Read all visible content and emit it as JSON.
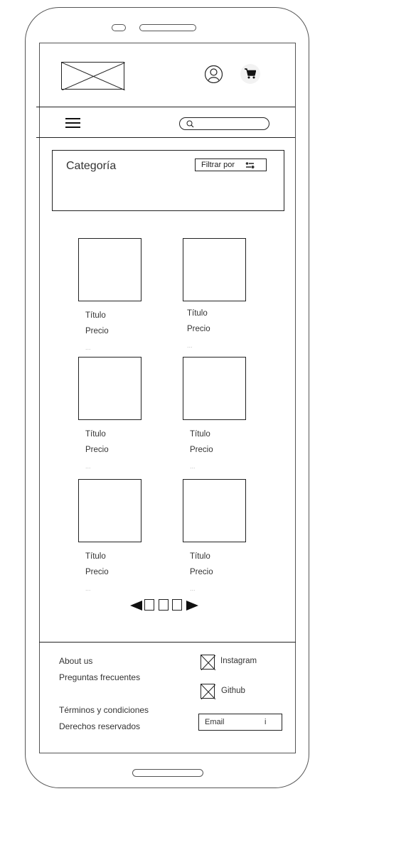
{
  "header": {
    "logo_icon": "image-placeholder-icon",
    "user_icon": "user-icon",
    "cart_icon": "shopping-cart-icon"
  },
  "nav": {
    "menu_icon": "hamburger-menu-icon",
    "search_icon": "search-icon",
    "search_value": ""
  },
  "category": {
    "title": "Categoría",
    "filter_label": "Filtrar por",
    "filter_icon": "filter-icon"
  },
  "products": [
    {
      "title": "Título",
      "price": "Precio",
      "more": "..."
    },
    {
      "title": "Título",
      "price": "Precio",
      "more": "..."
    },
    {
      "title": "Título",
      "price": "Precio",
      "more": "..."
    },
    {
      "title": "Título",
      "price": "Precio",
      "more": "..."
    },
    {
      "title": "Título",
      "price": "Precio",
      "more": "..."
    },
    {
      "title": "Título",
      "price": "Precio",
      "more": "..."
    }
  ],
  "pagination": {
    "prev_icon": "triangle-left-icon",
    "next_icon": "triangle-right-icon",
    "pages": 3
  },
  "footer": {
    "about": "About us",
    "faq": "Preguntas frecuentes",
    "terms": "Términos y condiciones",
    "rights": "Derechos reservados",
    "instagram": "Instagram",
    "github": "Github",
    "email_label": "Email",
    "email_cursor": "i"
  }
}
